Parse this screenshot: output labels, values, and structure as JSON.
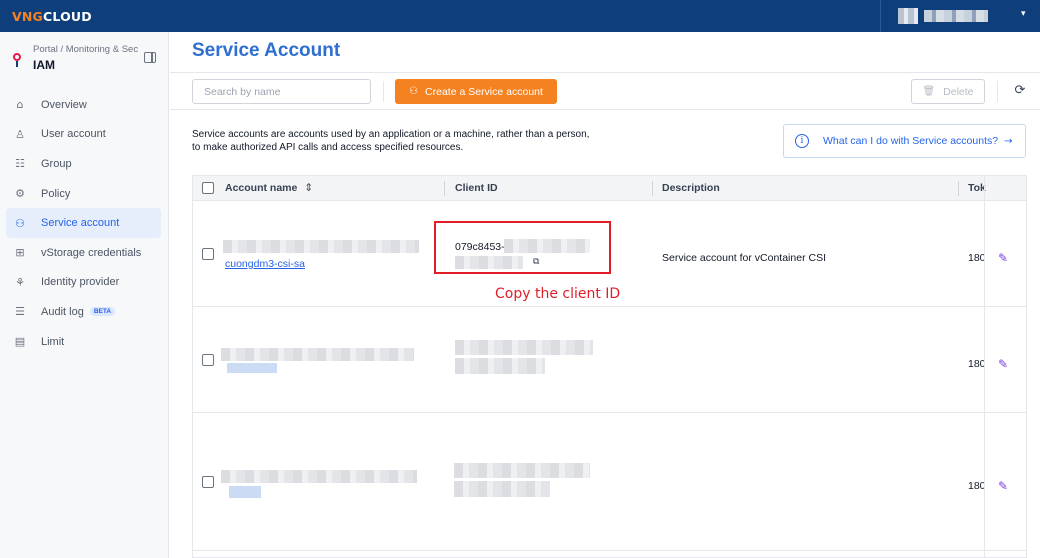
{
  "topbar": {
    "logo_part1": "VNG",
    "logo_part2": "CLOUD",
    "account_caret": "▾"
  },
  "sidebar": {
    "breadcrumb": "Portal / Monitoring & Sec",
    "title": "IAM",
    "items": [
      {
        "label": "Overview",
        "icon": "home-icon",
        "glyph": "⌂"
      },
      {
        "label": "User account",
        "icon": "user-icon",
        "glyph": "♙"
      },
      {
        "label": "Group",
        "icon": "group-icon",
        "glyph": "☷"
      },
      {
        "label": "Policy",
        "icon": "policy-icon",
        "glyph": "⚙"
      },
      {
        "label": "Service account",
        "icon": "service-account-icon",
        "glyph": "⚇",
        "active": true
      },
      {
        "label": "vStorage credentials",
        "icon": "storage-icon",
        "glyph": "⊞"
      },
      {
        "label": "Identity provider",
        "icon": "identity-provider-icon",
        "glyph": "⚘"
      },
      {
        "label": "Audit log",
        "icon": "audit-log-icon",
        "glyph": "☰",
        "badge": "BETA"
      },
      {
        "label": "Limit",
        "icon": "limit-icon",
        "glyph": "▤"
      }
    ]
  },
  "main": {
    "title": "Service Account",
    "search": {
      "placeholder": "Search by name",
      "value": ""
    },
    "create_label": "Create a Service account",
    "delete_label": "Delete",
    "description": "Service accounts are accounts used by an application or a machine, rather than a person, to make authorized API calls and access specified resources.",
    "info_link": "What can I do with Service accounts?",
    "table": {
      "headers": [
        "Account name",
        "Client ID",
        "Description",
        "Tok"
      ],
      "rows": [
        {
          "name": "cuongdm3-csi-sa",
          "client_id": "079c8453-",
          "description": "Service account for vContainer CSI",
          "token": "180"
        },
        {
          "name": "",
          "client_id": "",
          "description": "",
          "token": "180"
        },
        {
          "name": "",
          "client_id": "",
          "description": "",
          "token": "180"
        }
      ]
    }
  },
  "annotation": {
    "text": "Copy the client ID",
    "color": "#e11d2a"
  },
  "colors": {
    "topbar": "#0f3f7a",
    "accent": "#f58220",
    "link": "#2563eb",
    "title": "#2f6fd1"
  }
}
